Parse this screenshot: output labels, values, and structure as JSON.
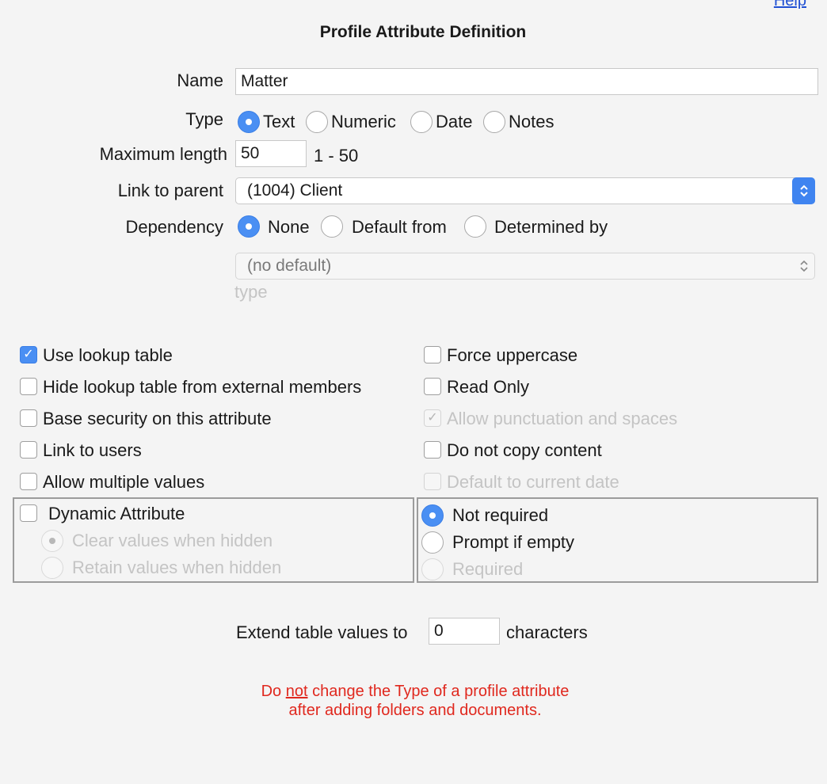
{
  "header": {
    "help_label": "Help",
    "title": "Profile Attribute Definition"
  },
  "form": {
    "name_label": "Name",
    "name_value": "Matter",
    "type_label": "Type",
    "type_options": [
      "Text",
      "Numeric",
      "Date",
      "Notes"
    ],
    "type_selected": "Text",
    "maxlen_label": "Maximum length",
    "maxlen_value": "50",
    "maxlen_range": "1 - 50",
    "parent_label": "Link to parent",
    "parent_value": "(1004) Client",
    "dependency_label": "Dependency",
    "dependency_options": [
      "None",
      "Default from",
      "Determined by"
    ],
    "dependency_selected": "None",
    "default_select_value": "(no default)",
    "default_type_caption": "type"
  },
  "options_left": [
    {
      "label": "Use lookup table",
      "checked": true,
      "enabled": true
    },
    {
      "label": "Hide lookup table from external members",
      "checked": false,
      "enabled": true
    },
    {
      "label": "Base security on this attribute",
      "checked": false,
      "enabled": true
    },
    {
      "label": "Link to users",
      "checked": false,
      "enabled": true
    },
    {
      "label": "Allow multiple values",
      "checked": false,
      "enabled": true
    }
  ],
  "options_right": [
    {
      "label": "Force uppercase",
      "checked": false,
      "enabled": true
    },
    {
      "label": "Read Only",
      "checked": false,
      "enabled": true
    },
    {
      "label": "Allow punctuation and spaces",
      "checked": true,
      "enabled": false
    },
    {
      "label": "Do not copy content",
      "checked": false,
      "enabled": true
    },
    {
      "label": "Default to current date",
      "checked": false,
      "enabled": false
    }
  ],
  "dynamic": {
    "label": "Dynamic Attribute",
    "checked": false,
    "options": [
      "Clear values when hidden",
      "Retain values when hidden"
    ],
    "selected": "Clear values when hidden"
  },
  "requirement": {
    "options": [
      "Not required",
      "Prompt if empty",
      "Required"
    ],
    "selected": "Not required"
  },
  "extend": {
    "prefix": "Extend table values to",
    "value": "0",
    "suffix": "characters"
  },
  "warning": {
    "part1": "Do ",
    "emphasis": "not",
    "part2": " change the Type of a profile attribute",
    "line2": "after adding folders and documents."
  },
  "colors": {
    "accent": "#4a8ff3",
    "warning": "#e0281e",
    "link": "#1f4fd3",
    "background": "#f4f4f4"
  }
}
